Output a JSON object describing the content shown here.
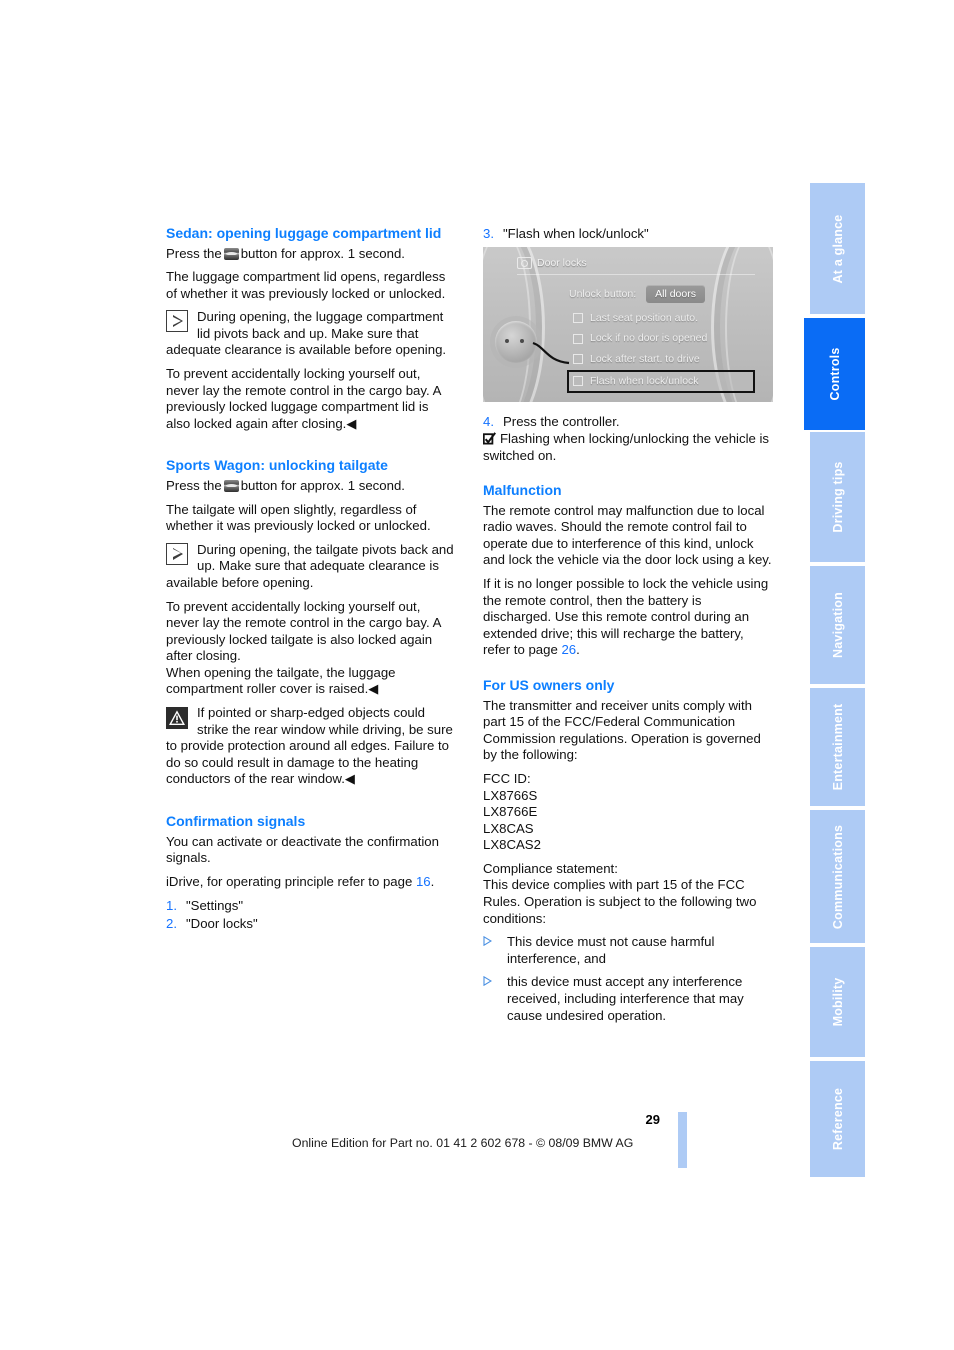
{
  "colors": {
    "heading_blue": "#0d7fff",
    "link_blue": "#1472ff",
    "tab_inactive": "#aecbf5",
    "tab_active": "#0a6cf5"
  },
  "sidebar": {
    "tabs": [
      {
        "label": "At a glance",
        "active": false
      },
      {
        "label": "Controls",
        "active": true
      },
      {
        "label": "Driving tips",
        "active": false
      },
      {
        "label": "Navigation",
        "active": false
      },
      {
        "label": "Entertainment",
        "active": false
      },
      {
        "label": "Communications",
        "active": false
      },
      {
        "label": "Mobility",
        "active": false
      },
      {
        "label": "Reference",
        "active": false
      }
    ]
  },
  "left_column": {
    "section1": {
      "heading": "Sedan: opening luggage compartment lid",
      "p_press_before": "Press the",
      "p_press_after": "button for approx. 1 second.",
      "p2": "The luggage compartment lid opens, regardless of whether it was previously locked or unlocked.",
      "note": "During opening, the luggage compartment lid pivots back and up. Make sure that adequate clearance is available before opening.",
      "note_cont": "To prevent accidentally locking yourself out, never lay the remote control in the cargo bay. A previously locked luggage compartment lid is also locked again after closing.◀"
    },
    "section2": {
      "heading": "Sports Wagon: unlocking tailgate",
      "p_press_before": "Press the",
      "p_press_after": "button for approx. 1 second.",
      "p2": "The tailgate will open slightly, regardless of whether it was previously locked or unlocked.",
      "note": "During opening, the tailgate pivots back and up. Make sure that adequate clearance is available before opening.",
      "note_cont": "To prevent accidentally locking yourself out, never lay the remote control in the cargo bay. A previously locked tailgate is also locked again after closing.",
      "note_cont2": "When opening the tailgate, the luggage compartment roller cover is raised.◀",
      "warning": "If pointed or sharp-edged objects could strike the rear window while driving, be sure to provide protection around all edges. Failure to do so could result in damage to the heating conductors of the rear window.◀"
    },
    "section3": {
      "heading": "Confirmation signals",
      "p1": "You can activate or deactivate the confirmation signals.",
      "p2_before": "iDrive, for operating principle refer to page",
      "p2_pageref": "16",
      "p2_after": ".",
      "steps": [
        {
          "num": "1.",
          "text": "\"Settings\""
        },
        {
          "num": "2.",
          "text": "\"Door locks\""
        }
      ]
    }
  },
  "right_column": {
    "step3": {
      "num": "3.",
      "text": "\"Flash when lock/unlock\""
    },
    "idrive": {
      "title": "Door locks",
      "unlock_label": "Unlock button:",
      "unlock_value": "All doors",
      "options": [
        {
          "label": "Last seat position auto.",
          "selected": false
        },
        {
          "label": "Lock if no door is opened",
          "selected": false
        },
        {
          "label": "Lock after start. to drive",
          "selected": false
        },
        {
          "label": "Flash when lock/unlock",
          "selected": true
        }
      ]
    },
    "step4": {
      "num": "4.",
      "text": "Press the controller."
    },
    "result": "Flashing when locking/unlocking the vehicle is switched on.",
    "malfunction": {
      "heading": "Malfunction",
      "p1": "The remote control may malfunction due to local radio waves. Should the remote control fail to operate due to interference of this kind, unlock and lock the vehicle via the door lock using a key.",
      "p2_before": "If it is no longer possible to lock the vehicle using the remote control, then the battery is discharged. Use this remote control during an extended drive; this will recharge the battery, refer to page",
      "p2_pageref": "26",
      "p2_after": "."
    },
    "us_owners": {
      "heading": "For US owners only",
      "p1": "The transmitter and receiver units comply with part 15 of the FCC/Federal Communication Commission regulations. Operation is governed by the following:",
      "fcc_label": "FCC ID:",
      "fcc_ids": [
        "LX8766S",
        "LX8766E",
        "LX8CAS",
        "LX8CAS2"
      ],
      "compliance_label": "Compliance statement:",
      "compliance_text": "This device complies with part 15 of the FCC Rules. Operation is subject to the following two conditions:",
      "bullets": [
        "This device must not cause harmful interference, and",
        "this device must accept any interference received, including interference that may cause undesired operation."
      ]
    }
  },
  "footer": {
    "page_number": "29",
    "text": "Online Edition for Part no. 01 41 2 602 678 - © 08/09 BMW AG"
  }
}
